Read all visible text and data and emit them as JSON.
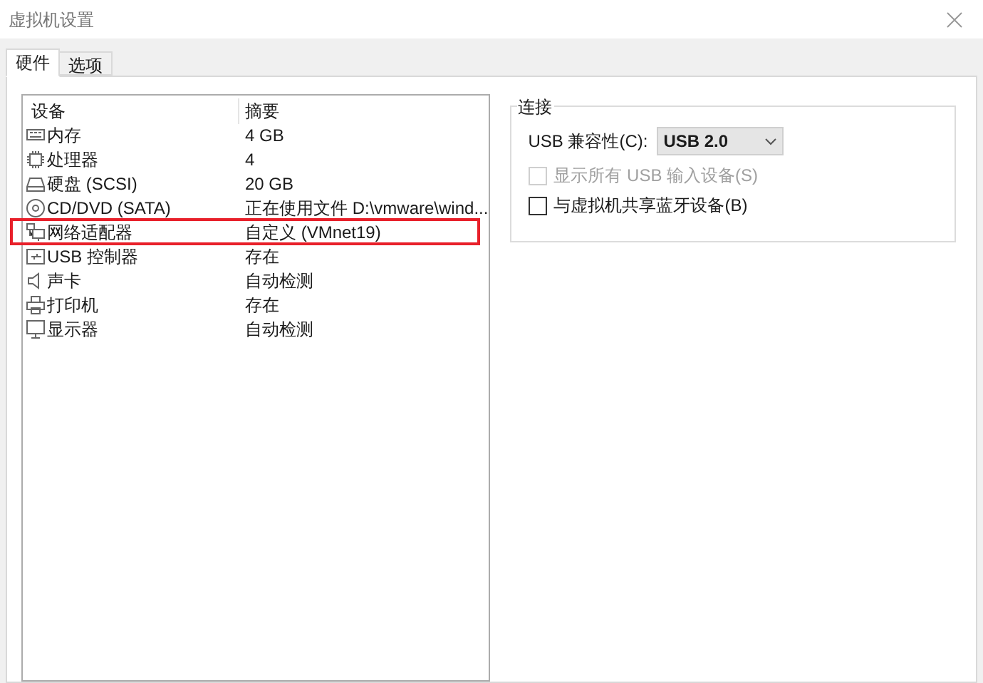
{
  "window": {
    "title": "虚拟机设置"
  },
  "tabs": [
    {
      "label": "硬件",
      "selected": true
    },
    {
      "label": "选项",
      "selected": false
    }
  ],
  "devices": {
    "columns": [
      "设备",
      "摘要"
    ],
    "rows": [
      {
        "kind": "memory",
        "name": "内存",
        "summary": "4 GB",
        "highlighted": false
      },
      {
        "kind": "cpu",
        "name": "处理器",
        "summary": "4",
        "highlighted": false
      },
      {
        "kind": "disk",
        "name": "硬盘 (SCSI)",
        "summary": "20 GB",
        "highlighted": false
      },
      {
        "kind": "cd",
        "name": "CD/DVD (SATA)",
        "summary": "正在使用文件 D:\\vmware\\wind...",
        "highlighted": false
      },
      {
        "kind": "network",
        "name": "网络适配器",
        "summary": "自定义 (VMnet19)",
        "highlighted": true
      },
      {
        "kind": "usb",
        "name": "USB 控制器",
        "summary": "存在",
        "highlighted": false
      },
      {
        "kind": "sound",
        "name": "声卡",
        "summary": "自动检测",
        "highlighted": false
      },
      {
        "kind": "printer",
        "name": "打印机",
        "summary": "存在",
        "highlighted": false
      },
      {
        "kind": "display",
        "name": "显示器",
        "summary": "自动检测",
        "highlighted": false
      }
    ]
  },
  "connection": {
    "title": "连接",
    "compat_label": "USB 兼容性(C):",
    "compat_value": "USB 2.0",
    "options": [
      {
        "label": "显示所有 USB 输入设备(S)",
        "checked": false,
        "disabled": true
      },
      {
        "label": "与虚拟机共享蓝牙设备(B)",
        "checked": false,
        "disabled": false
      }
    ]
  }
}
